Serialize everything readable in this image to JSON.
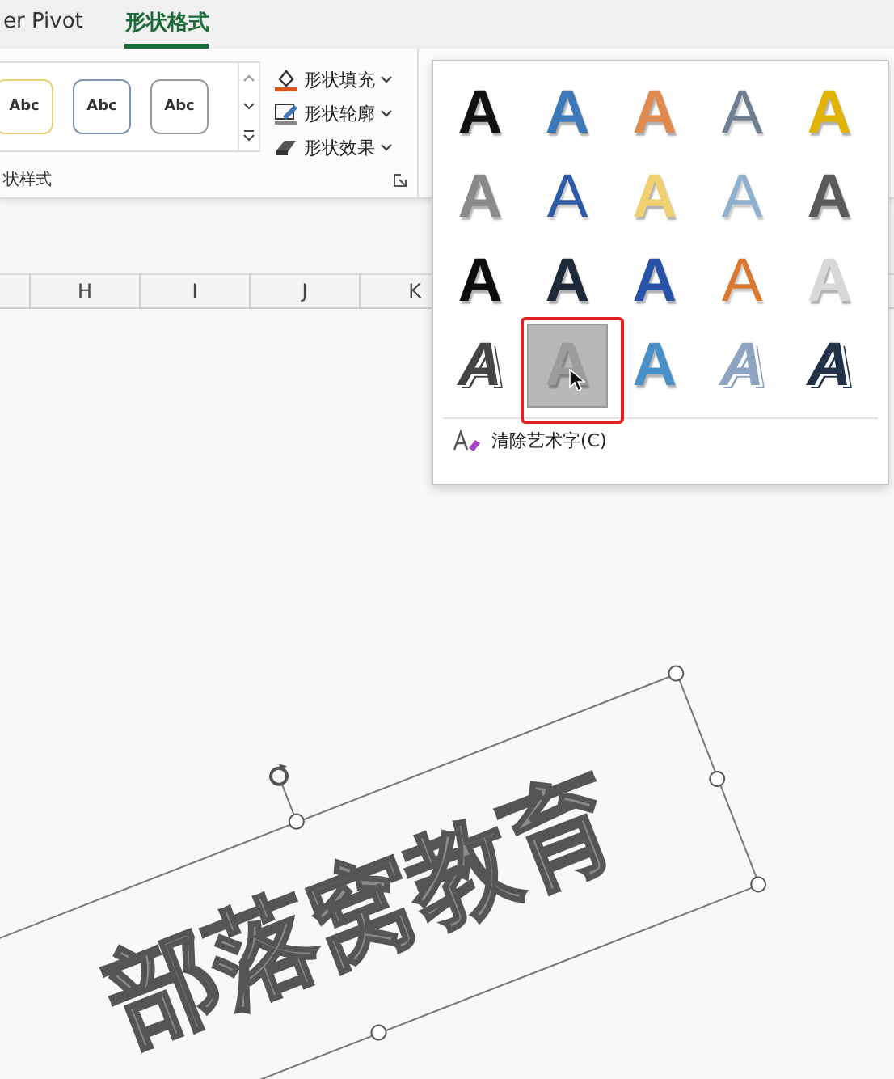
{
  "ribbon_tabs": [
    {
      "label": "er Pivot",
      "selected": false
    },
    {
      "label": "形状格式",
      "selected": true
    }
  ],
  "shape_styles": {
    "presets": [
      {
        "label": "Abc",
        "color": "#e8d27a"
      },
      {
        "label": "Abc",
        "color": "#7f93ad"
      },
      {
        "label": "Abc",
        "color": "#9a9a9a"
      }
    ],
    "commands": [
      {
        "label": "形状填充",
        "kind": "fill"
      },
      {
        "label": "形状轮廓",
        "kind": "outline"
      },
      {
        "label": "形状效果",
        "kind": "effects"
      }
    ],
    "group_label": "状样式"
  },
  "column_headers": [
    "H",
    "I",
    "J",
    "K"
  ],
  "wordart_gallery": {
    "items": [
      {
        "label": "A",
        "kind": "solid",
        "color": "#111111",
        "selected": false
      },
      {
        "label": "A",
        "kind": "solid",
        "color": "#3d78b8",
        "selected": false
      },
      {
        "label": "A",
        "kind": "solid",
        "color": "#e08a50",
        "selected": false
      },
      {
        "label": "A",
        "kind": "outline",
        "color": "#6f7f90",
        "selected": false
      },
      {
        "label": "A",
        "kind": "solid",
        "color": "#e0b400",
        "selected": false
      },
      {
        "label": "A",
        "kind": "solid",
        "color": "#8a8a8a",
        "selected": false
      },
      {
        "label": "A",
        "kind": "outline",
        "color": "#2f5aa8",
        "selected": false
      },
      {
        "label": "A",
        "kind": "solid",
        "color": "#f0d070",
        "selected": false
      },
      {
        "label": "A",
        "kind": "outline",
        "color": "#8fb0cf",
        "selected": false
      },
      {
        "label": "A",
        "kind": "solid",
        "color": "#5a5a5a",
        "selected": false
      },
      {
        "label": "A",
        "kind": "solid",
        "color": "#0c0c0c",
        "selected": false
      },
      {
        "label": "A",
        "kind": "solid",
        "color": "#1e2a3a",
        "selected": false
      },
      {
        "label": "A",
        "kind": "solid",
        "color": "#2752a8",
        "selected": false
      },
      {
        "label": "A",
        "kind": "outline",
        "color": "#d9782e",
        "selected": false
      },
      {
        "label": "A",
        "kind": "solid",
        "color": "#d8d8d8",
        "selected": false
      },
      {
        "label": "A",
        "kind": "hatched",
        "color": "#444444",
        "selected": false
      },
      {
        "label": "A",
        "kind": "solid",
        "color": "#9c9c9c",
        "selected": true
      },
      {
        "label": "A",
        "kind": "solid",
        "color": "#4a90c8",
        "selected": false
      },
      {
        "label": "A",
        "kind": "hatched",
        "color": "#8ea4c0",
        "selected": false
      },
      {
        "label": "A",
        "kind": "hatched",
        "color": "#22324a",
        "selected": false
      }
    ],
    "clear_label": "清除艺术字(C)"
  },
  "wordart_text": "部落窝教育"
}
